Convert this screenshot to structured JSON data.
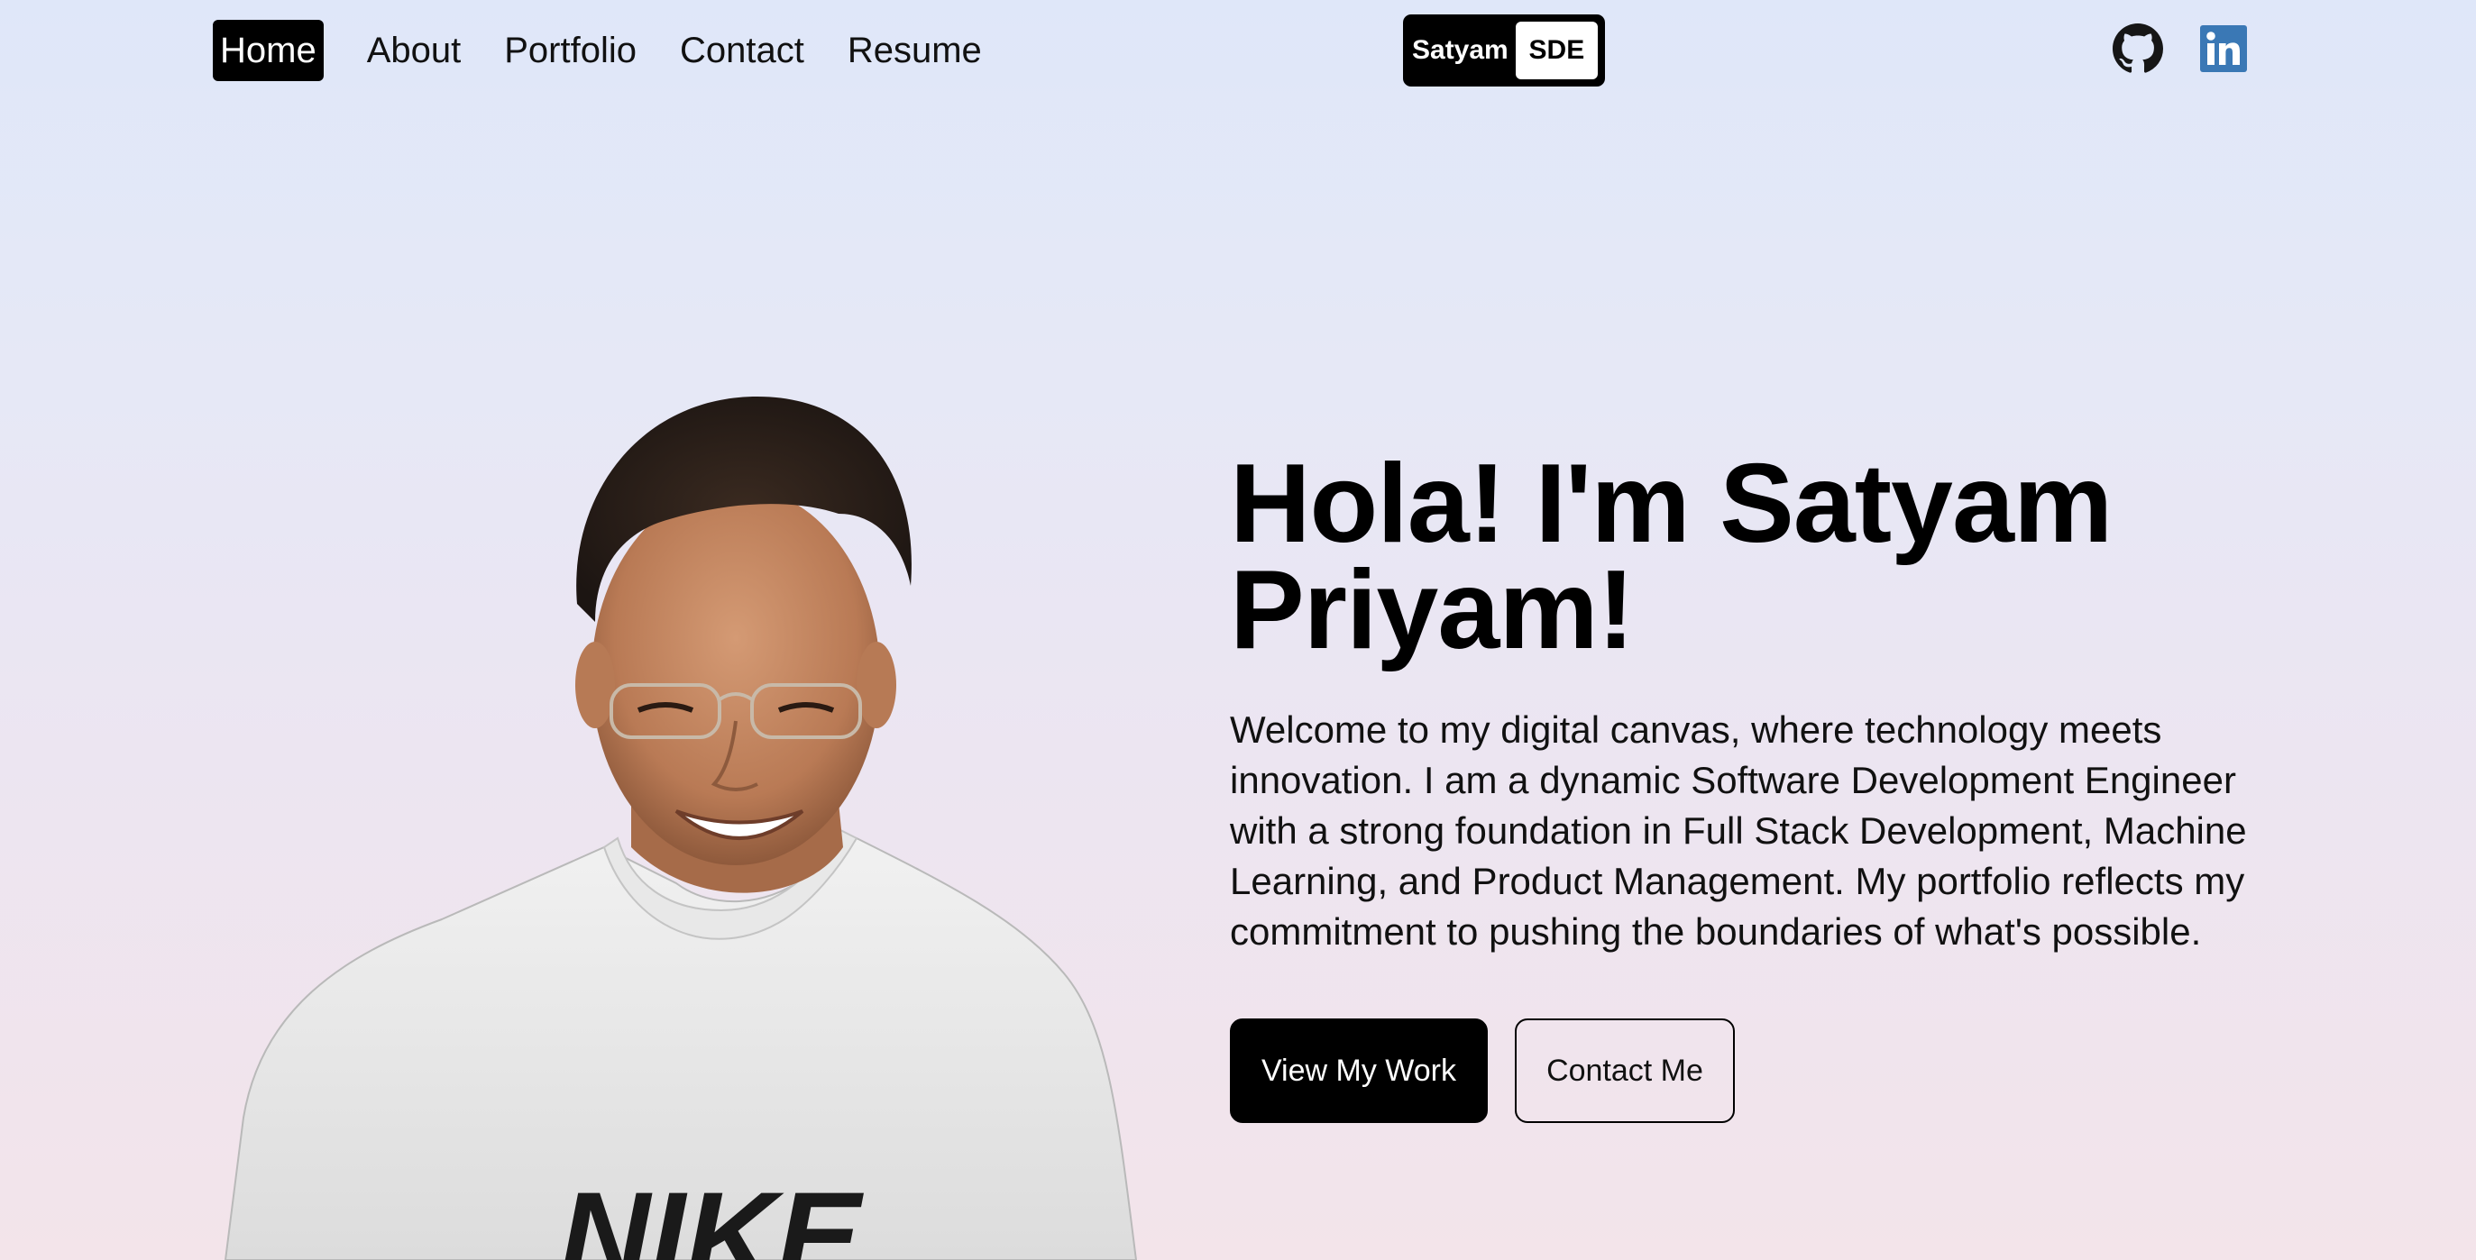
{
  "nav": {
    "items": [
      {
        "label": "Home",
        "active": true
      },
      {
        "label": "About",
        "active": false
      },
      {
        "label": "Portfolio",
        "active": false
      },
      {
        "label": "Contact",
        "active": false
      },
      {
        "label": "Resume",
        "active": false
      }
    ]
  },
  "brand": {
    "name": "Satyam",
    "tag": "SDE"
  },
  "social": {
    "icons": [
      "github-icon",
      "linkedin-icon"
    ],
    "linkedin_color": "#3a78b5",
    "github_color": "#161616"
  },
  "hero": {
    "title_line1": "Hola! I'm Satyam",
    "title_line2": "Priyam!",
    "description": "Welcome to my digital canvas, where technology meets innovation. I am a dynamic Software Development Engineer with a strong foundation in Full Stack Development, Machine Learning, and Product Management. My portfolio reflects my commitment to pushing the boundaries of what's possible.",
    "primary_button": "View My Work",
    "secondary_button": "Contact Me",
    "shirt_print": "NIKE"
  },
  "colors": {
    "background_top": "#dfe7f9",
    "background_bottom": "#f3e4ea",
    "primary": "#000000"
  }
}
